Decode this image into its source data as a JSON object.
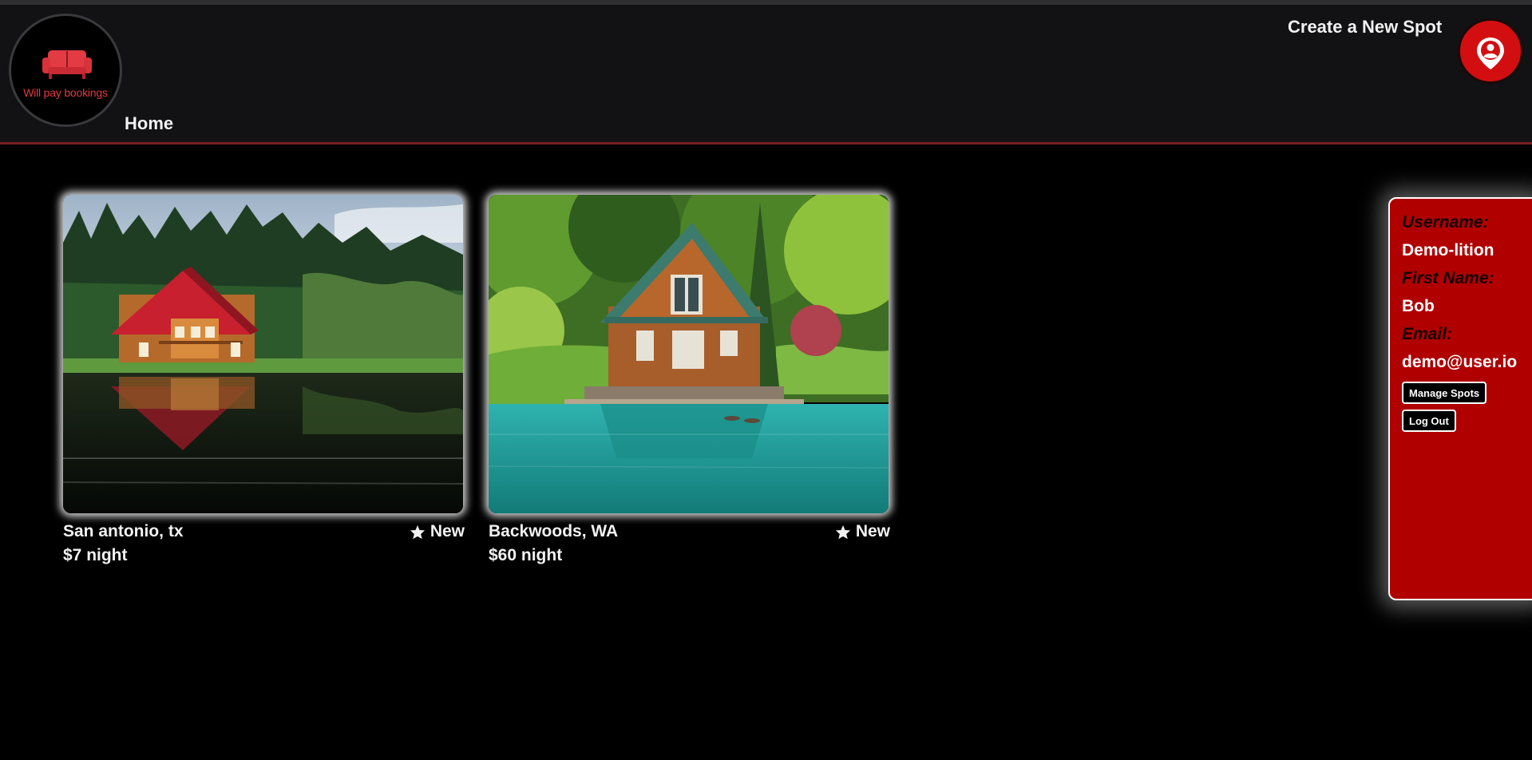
{
  "header": {
    "logo_text": "Will pay bookings",
    "home_label": "Home",
    "create_spot_label": "Create a New Spot"
  },
  "spots": [
    {
      "location": "San antonio, tx",
      "rating": "New",
      "price": "$7 night",
      "image": "log cabin with red roof by a lake"
    },
    {
      "location": "Backwoods, WA",
      "rating": "New",
      "price": "$60 night",
      "image": "cedar cabin with green roof by a turquoise lake"
    }
  ],
  "profile_menu": {
    "username_label": "Username:",
    "username": "Demo-lition",
    "first_name_label": "First Name:",
    "first_name": "Bob",
    "email_label": "Email:",
    "email": "demo@user.io",
    "manage_spots_label": "Manage Spots",
    "logout_label": "Log Out"
  },
  "colors": {
    "accent_red": "#b00000",
    "header_bg": "#121113",
    "page_bg": "#000000"
  }
}
